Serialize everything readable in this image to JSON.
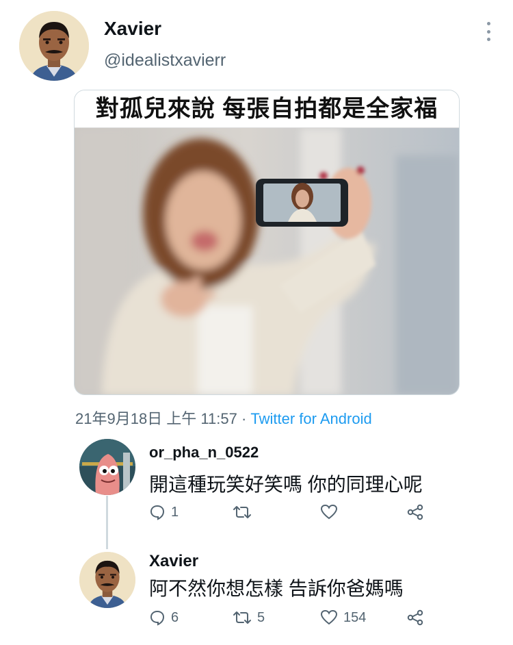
{
  "tweet": {
    "author_name": "Xavier",
    "author_handle": "@idealistxavierr",
    "avatar_icon": "profile-photo",
    "more_icon": "more-vertical-icon",
    "meme_caption": "對孤兒來說 每張自拍都是全家福",
    "meme_image": "woman-taking-selfie-photo",
    "timestamp": "21年9月18日 上午 11:57",
    "separator": " · ",
    "source": "Twitter for Android"
  },
  "replies": [
    {
      "username": "or_pha_n_0522",
      "avatar_icon": "cartoon-character-avatar",
      "text": "開這種玩笑好笑嗎 你的同理心呢",
      "reply_count": "1",
      "retweet_count": "",
      "like_count": ""
    },
    {
      "username": "Xavier",
      "avatar_icon": "profile-photo",
      "text": "阿不然你想怎樣 告訴你爸媽嗎",
      "reply_count": "6",
      "retweet_count": "5",
      "like_count": "154"
    }
  ],
  "colors": {
    "text": "#0f1419",
    "secondary": "#536471",
    "link": "#1d9bf0",
    "border": "#cfd9de"
  }
}
